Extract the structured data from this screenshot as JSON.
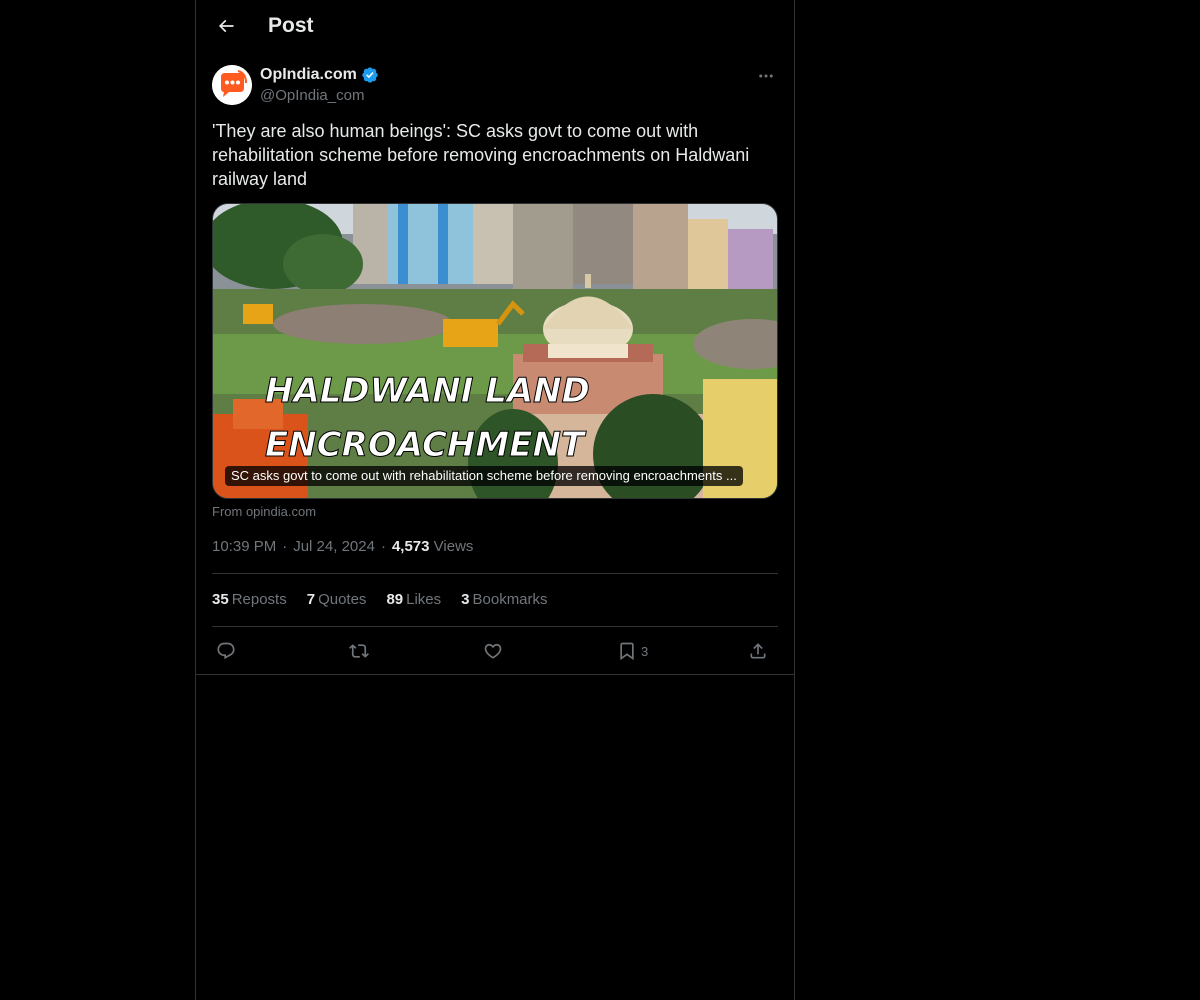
{
  "header": {
    "title": "Post",
    "back_icon": "arrow-left-icon"
  },
  "author": {
    "display_name": "OpIndia.com",
    "handle": "@OpIndia_com",
    "verified": true,
    "verified_color": "#1d9bf0",
    "avatar_icon": "speech-bubble-logo",
    "avatar_color": "#ff5a1f"
  },
  "post": {
    "text": "'They are also human beings': SC asks govt to come out with rehabilitation scheme before removing encroachments on Haldwani railway land"
  },
  "link_card": {
    "image_text_line1": "HALDWANI LAND",
    "image_text_line2": "ENCROACHMENT",
    "title": "SC asks govt to come out with rehabilitation scheme before removing encroachments ...",
    "source": "From opindia.com"
  },
  "meta": {
    "time": "10:39 PM",
    "date": "Jul 24, 2024",
    "views_count": "4,573",
    "views_label": "Views",
    "separator": "·"
  },
  "stats": {
    "reposts": {
      "count": "35",
      "label": "Reposts"
    },
    "quotes": {
      "count": "7",
      "label": "Quotes"
    },
    "likes": {
      "count": "89",
      "label": "Likes"
    },
    "bookmarks": {
      "count": "3",
      "label": "Bookmarks"
    }
  },
  "actions": {
    "reply_icon": "reply-icon",
    "repost_icon": "repost-icon",
    "like_icon": "heart-icon",
    "bookmark_icon": "bookmark-icon",
    "bookmark_count": "3",
    "share_icon": "share-icon"
  },
  "colors": {
    "background": "#000000",
    "border": "#2f3336",
    "text_primary": "#e7e9ea",
    "text_secondary": "#71767b"
  }
}
